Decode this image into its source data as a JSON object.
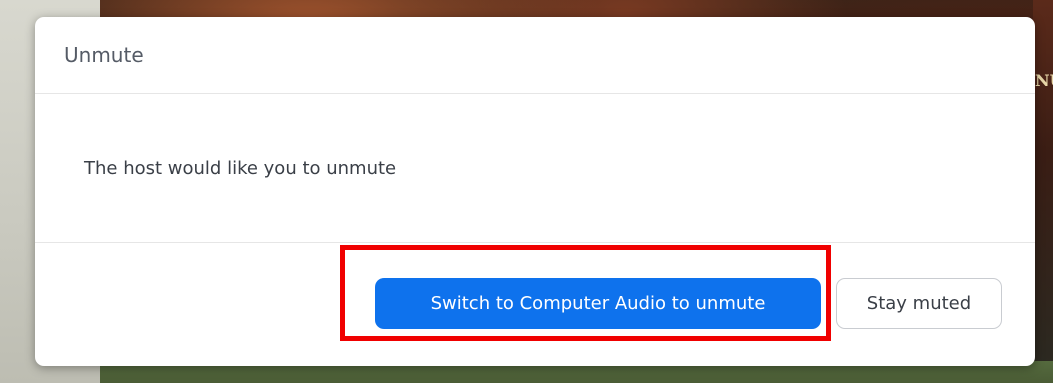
{
  "dialog": {
    "title": "Unmute",
    "message": "The host would like you to unmute",
    "primary_button_label": "Switch to Computer Audio to unmute",
    "secondary_button_label": "Stay muted"
  },
  "background": {
    "right_edge_letters": "NU"
  },
  "colors": {
    "primary_button": "#0e72ed",
    "highlight_outline": "#f00000",
    "dialog_background": "#ffffff"
  }
}
